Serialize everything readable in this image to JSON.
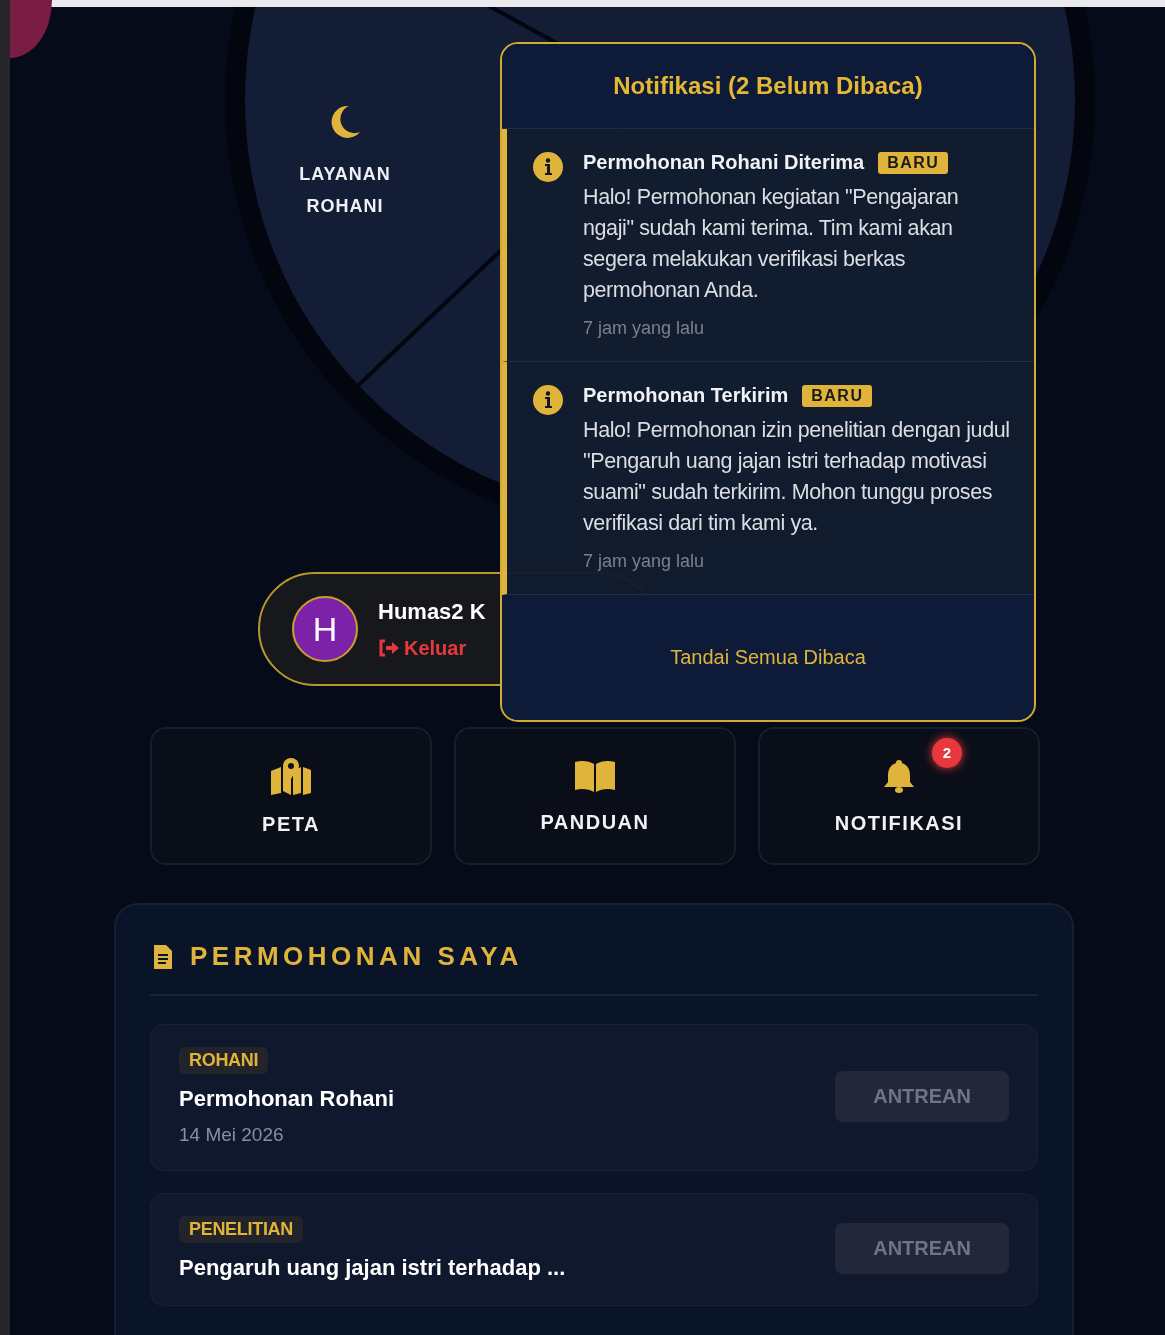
{
  "service_wheel": {
    "segments": [
      {
        "label": "LAYANAN ROHANI",
        "kind": "moon"
      }
    ]
  },
  "profile": {
    "avatar_letter": "H",
    "name": "Humas2 K",
    "logout": "Keluar"
  },
  "notifications": {
    "title": "Notifikasi (2 Belum Dibaca)",
    "items": [
      {
        "title": "Permohonan Rohani Diterima",
        "badge": "BARU",
        "unread": true,
        "body": "Halo! Permohonan kegiatan \"Pengajaran ngaji\" sudah kami terima. Tim kami akan segera melakukan verifikasi berkas permohonan Anda.",
        "time": "7 jam yang lalu"
      },
      {
        "title": "Permohonan Terkirim",
        "badge": "BARU",
        "unread": true,
        "body": "Halo! Permohonan izin penelitian dengan judul \"Pengaruh uang jajan istri terhadap motivasi suami\" sudah terkirim. Mohon tunggu proses verifikasi dari tim kami ya.",
        "time": "7 jam yang lalu"
      }
    ],
    "mark_all": "Tandai Semua Dibaca"
  },
  "quick_menu": [
    {
      "label": "PETA",
      "kind": "map"
    },
    {
      "label": "PANDUAN",
      "kind": "book"
    },
    {
      "label": "NOTIFIKASI",
      "kind": "bell",
      "badge": "2"
    }
  ],
  "requests": {
    "title": "PERMOHONAN SAYA",
    "items": [
      {
        "category": "ROHANI",
        "title": "Permohonan Rohani",
        "date": "14 Mei 2026",
        "status": "ANTREAN"
      },
      {
        "category": "PENELITIAN",
        "title": "Pengaruh uang jajan istri terhadap ...",
        "status": "ANTREAN"
      }
    ]
  }
}
